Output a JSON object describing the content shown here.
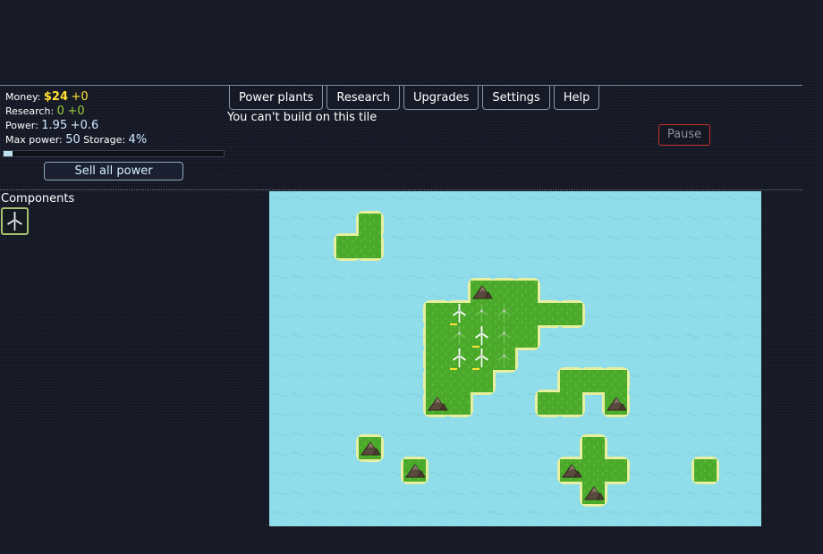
{
  "stats": {
    "money_label": "Money:",
    "money_value": "$24",
    "money_delta": "+0",
    "research_label": "Research:",
    "research_value": "0",
    "research_delta": "+0",
    "power_label": "Power:",
    "power_value": "1.95",
    "power_delta": "+0.6",
    "max_power_label": "Max power:",
    "max_power_value": "50",
    "storage_label": "Storage:",
    "storage_value": "4%",
    "storage_fill_fraction": 0.04
  },
  "sell_button_label": "Sell all power",
  "tabs": [
    {
      "label": "Power plants"
    },
    {
      "label": "Research"
    },
    {
      "label": "Upgrades"
    },
    {
      "label": "Settings"
    },
    {
      "label": "Help"
    }
  ],
  "message": "You can't build on this tile",
  "pause_label": "Pause",
  "components_title": "Components",
  "component_icon": "wind-turbine-icon",
  "colors": {
    "water": "#8fdcea",
    "grass": "#4aa82a",
    "grass_shore": "#e8f0a0",
    "money": "#ffe033",
    "research": "#9bd13b",
    "pause_border": "#c83030"
  },
  "map": {
    "land_tiles": [
      [
        4,
        1
      ],
      [
        3,
        2
      ],
      [
        4,
        2
      ],
      [
        9,
        4
      ],
      [
        10,
        4
      ],
      [
        11,
        4
      ],
      [
        7,
        5
      ],
      [
        8,
        5
      ],
      [
        9,
        5
      ],
      [
        10,
        5
      ],
      [
        11,
        5
      ],
      [
        12,
        5
      ],
      [
        13,
        5
      ],
      [
        7,
        6
      ],
      [
        8,
        6
      ],
      [
        9,
        6
      ],
      [
        10,
        6
      ],
      [
        11,
        6
      ],
      [
        7,
        7
      ],
      [
        8,
        7
      ],
      [
        9,
        7
      ],
      [
        10,
        7
      ],
      [
        7,
        8
      ],
      [
        8,
        8
      ],
      [
        9,
        8
      ],
      [
        13,
        8
      ],
      [
        14,
        8
      ],
      [
        15,
        8
      ],
      [
        7,
        9
      ],
      [
        8,
        9
      ],
      [
        12,
        9
      ],
      [
        13,
        9
      ],
      [
        15,
        9
      ],
      [
        4,
        11
      ],
      [
        14,
        11
      ],
      [
        6,
        12
      ],
      [
        13,
        12
      ],
      [
        14,
        12
      ],
      [
        15,
        12
      ],
      [
        19,
        12
      ],
      [
        14,
        13
      ]
    ],
    "mountains": [
      [
        9,
        4
      ],
      [
        7,
        9
      ],
      [
        15,
        9
      ],
      [
        4,
        11
      ],
      [
        6,
        12
      ],
      [
        13,
        12
      ],
      [
        14,
        13
      ]
    ],
    "turbines": [
      [
        8,
        5
      ],
      [
        9,
        6
      ],
      [
        8,
        7
      ],
      [
        9,
        7
      ]
    ],
    "ghost_turbines": [
      [
        9,
        5
      ],
      [
        10,
        5
      ],
      [
        8,
        6
      ],
      [
        10,
        6
      ],
      [
        10,
        7
      ]
    ]
  }
}
